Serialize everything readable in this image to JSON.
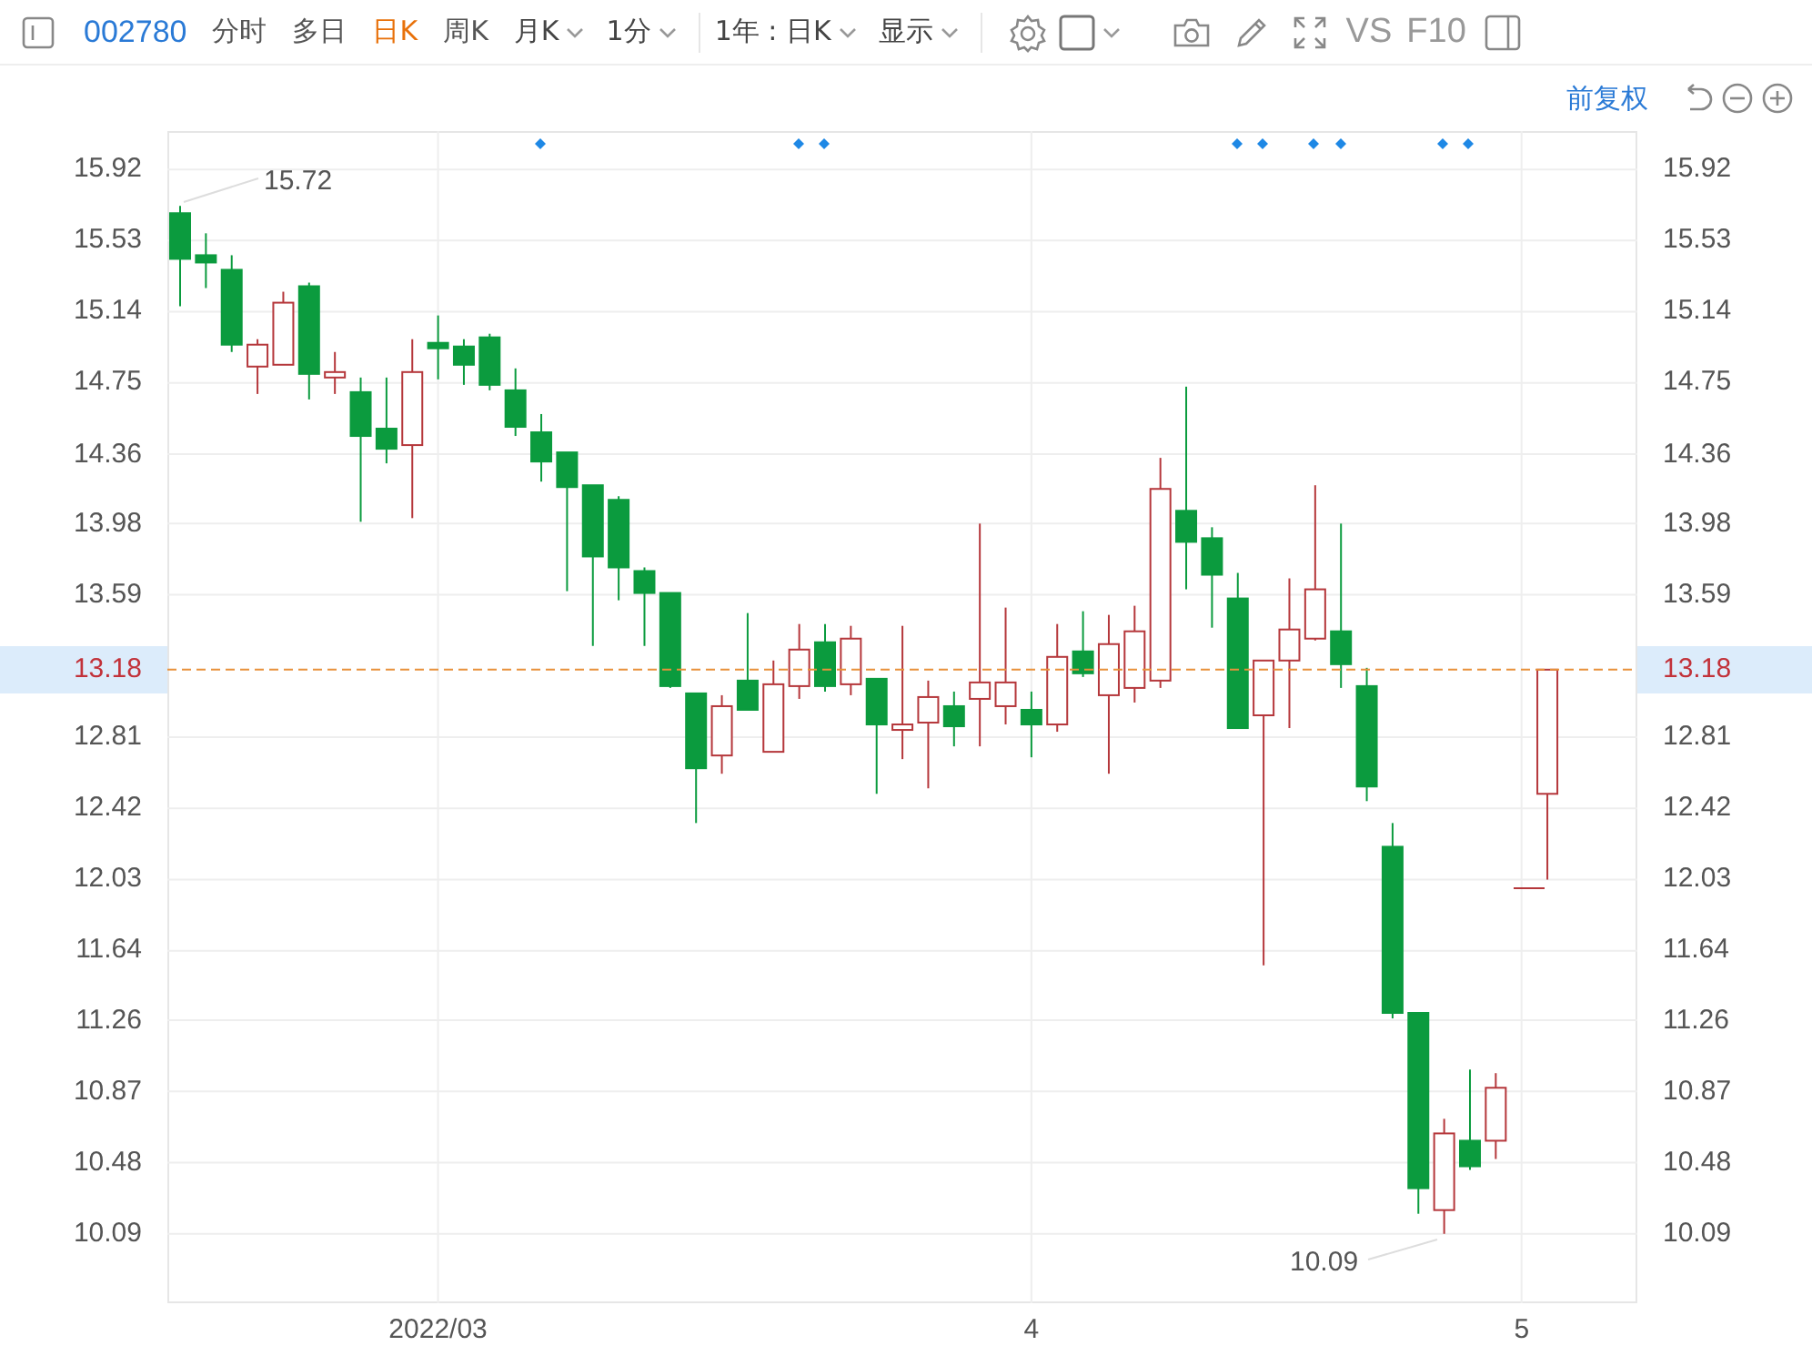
{
  "toolbar": {
    "code": "002780",
    "items": [
      {
        "kind": "tab",
        "label": "分时",
        "selected": false
      },
      {
        "kind": "tab",
        "label": "多日",
        "selected": false
      },
      {
        "kind": "tab",
        "label": "日K",
        "selected": true
      },
      {
        "kind": "tab",
        "label": "周K",
        "selected": false
      },
      {
        "kind": "dropdown",
        "label": "月K"
      },
      {
        "kind": "dropdown",
        "label": "1分"
      },
      {
        "kind": "dropdown",
        "label": "1年 : 日K"
      },
      {
        "kind": "dropdown",
        "label": "显示"
      }
    ],
    "tools": [
      "VS",
      "F10"
    ]
  },
  "adjust": {
    "label": "前复权"
  },
  "current_price_labels": [
    "13.18",
    "13.18"
  ],
  "annotations": {
    "high": "15.72",
    "low": "10.09"
  },
  "chart": {
    "chart_data": {
      "type": "candlestick",
      "categories": [
        null,
        null,
        null,
        null,
        null,
        null,
        null,
        null,
        null,
        null,
        "2022/03",
        null,
        null,
        null,
        null,
        null,
        null,
        null,
        null,
        null,
        null,
        null,
        null,
        null,
        null,
        null,
        null,
        null,
        null,
        null,
        null,
        null,
        null,
        "4",
        null,
        null,
        null,
        null,
        null,
        null,
        null,
        null,
        null,
        null,
        null,
        null,
        null,
        null,
        null,
        null,
        null,
        null,
        "5",
        null
      ],
      "ohlc": [
        [
          15.68,
          15.72,
          15.17,
          15.43
        ],
        [
          15.45,
          15.57,
          15.27,
          15.41
        ],
        [
          15.37,
          15.45,
          14.92,
          14.96
        ],
        [
          14.84,
          14.99,
          14.69,
          14.96
        ],
        [
          14.85,
          15.25,
          14.85,
          15.19
        ],
        [
          15.28,
          15.3,
          14.66,
          14.8
        ],
        [
          14.78,
          14.92,
          14.69,
          14.81
        ],
        [
          14.7,
          14.78,
          13.99,
          14.46
        ],
        [
          14.5,
          14.78,
          14.31,
          14.39
        ],
        [
          14.41,
          14.99,
          14.01,
          14.81
        ],
        [
          14.97,
          15.12,
          14.77,
          14.94
        ],
        [
          14.95,
          14.99,
          14.74,
          14.85
        ],
        [
          15.0,
          15.02,
          14.71,
          14.74
        ],
        [
          14.71,
          14.83,
          14.46,
          14.51
        ],
        [
          14.48,
          14.58,
          14.21,
          14.32
        ],
        [
          14.37,
          14.37,
          13.61,
          14.18
        ],
        [
          14.19,
          14.19,
          13.31,
          13.8
        ],
        [
          14.11,
          14.13,
          13.56,
          13.74
        ],
        [
          13.72,
          13.74,
          13.31,
          13.6
        ],
        [
          13.6,
          13.6,
          13.08,
          13.09
        ],
        [
          13.05,
          13.05,
          12.34,
          12.64
        ],
        [
          12.71,
          13.04,
          12.61,
          12.98
        ],
        [
          13.12,
          13.49,
          12.96,
          12.96
        ],
        [
          12.73,
          13.23,
          12.73,
          13.1
        ],
        [
          13.09,
          13.43,
          13.02,
          13.29
        ],
        [
          13.33,
          13.43,
          13.06,
          13.09
        ],
        [
          13.1,
          13.42,
          13.04,
          13.35
        ],
        [
          13.13,
          13.13,
          12.5,
          12.88
        ],
        [
          12.85,
          13.42,
          12.69,
          12.88
        ],
        [
          12.89,
          13.12,
          12.53,
          13.03
        ],
        [
          12.98,
          13.06,
          12.76,
          12.87
        ],
        [
          13.02,
          13.98,
          12.76,
          13.11
        ],
        [
          12.98,
          13.52,
          12.88,
          13.11
        ],
        [
          12.96,
          13.06,
          12.7,
          12.88
        ],
        [
          12.88,
          13.43,
          12.84,
          13.25
        ],
        [
          13.28,
          13.5,
          13.14,
          13.16
        ],
        [
          13.04,
          13.48,
          12.61,
          13.32
        ],
        [
          13.08,
          13.53,
          13.0,
          13.39
        ],
        [
          13.12,
          14.34,
          13.08,
          14.17
        ],
        [
          14.05,
          14.73,
          13.62,
          13.88
        ],
        [
          13.9,
          13.96,
          13.41,
          13.7
        ],
        [
          13.57,
          13.71,
          12.86,
          12.86
        ],
        [
          12.93,
          13.23,
          11.56,
          13.23
        ],
        [
          13.23,
          13.68,
          12.86,
          13.4
        ],
        [
          13.35,
          14.19,
          13.34,
          13.62
        ],
        [
          13.39,
          13.98,
          13.08,
          13.21
        ],
        [
          13.09,
          13.19,
          12.46,
          12.54
        ],
        [
          12.21,
          12.34,
          11.27,
          11.3
        ],
        [
          11.3,
          11.3,
          10.2,
          10.34
        ],
        [
          10.22,
          10.72,
          10.09,
          10.64
        ],
        [
          10.6,
          10.99,
          10.44,
          10.46
        ],
        [
          10.6,
          10.97,
          10.5,
          10.89
        ],
        null,
        [
          12.5,
          13.18,
          12.03,
          13.18
        ]
      ],
      "ylim": [
        9.71,
        16.13
      ],
      "grid": true,
      "ref_lines": [
        {
          "axis": "y",
          "value": 13.18,
          "color": "#e8913a"
        }
      ],
      "yticks": [
        15.92,
        15.53,
        15.14,
        14.75,
        14.36,
        13.98,
        13.59,
        12.81,
        12.42,
        12.03,
        11.64,
        11.26,
        10.87,
        10.48,
        10.09
      ]
    },
    "right_axis": [
      "15.92",
      "15.53",
      "15.14",
      "14.75",
      "14.36",
      "13.98",
      "13.59",
      "12.81",
      "12.42",
      "12.03",
      "11.64",
      "11.26",
      "10.87",
      "10.48",
      "10.09"
    ]
  }
}
